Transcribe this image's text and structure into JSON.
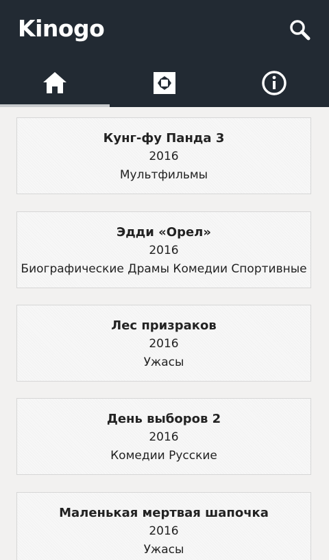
{
  "app": {
    "title": "Kinogo"
  },
  "colors": {
    "appbar": "#222a33",
    "background": "#f2f1f0",
    "indicator": "#c7cacd"
  },
  "tabs": [
    {
      "icon": "home-icon",
      "active": true
    },
    {
      "icon": "fullscreen-icon",
      "active": false
    },
    {
      "icon": "info-icon",
      "active": false
    }
  ],
  "movies": [
    {
      "title": "Кунг-фу Панда 3",
      "year": "2016",
      "genres": "Мультфильмы"
    },
    {
      "title": "Эдди «Орел»",
      "year": "2016",
      "genres": "Биографические Драмы Комедии Спортивные"
    },
    {
      "title": "Лес призраков",
      "year": "2016",
      "genres": "Ужасы"
    },
    {
      "title": "День выборов 2",
      "year": "2016",
      "genres": "Комедии Русские"
    },
    {
      "title": "Маленькая мертвая шапочка",
      "year": "2016",
      "genres": "Ужасы"
    }
  ]
}
